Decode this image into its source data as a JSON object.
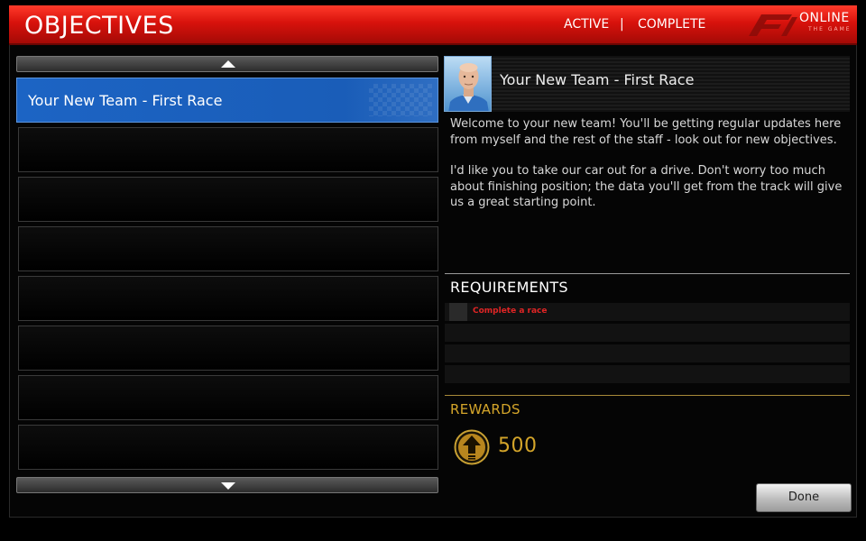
{
  "header": {
    "title": "OBJECTIVES",
    "tabs": {
      "active": "ACTIVE",
      "separator": "|",
      "complete": "COMPLETE"
    },
    "logo": {
      "text": "ONLINE",
      "sub": "THE GAME",
      "icon": "f1-logo-icon"
    }
  },
  "objectives": {
    "scroll_up_icon": "chevron-up-icon",
    "scroll_down_icon": "chevron-down-icon",
    "items": [
      {
        "label": "Your New Team - First Race",
        "selected": true
      },
      {
        "label": ""
      },
      {
        "label": ""
      },
      {
        "label": ""
      },
      {
        "label": ""
      },
      {
        "label": ""
      },
      {
        "label": ""
      },
      {
        "label": ""
      }
    ]
  },
  "detail": {
    "title": "Your New Team - First Race",
    "message": [
      "Welcome to your new team! You'll be getting regular updates here from myself and the rest of the staff - look out for new objectives.",
      "I'd like you to take our car out for a drive. Don't worry too much about finishing position; the data you'll get from the track will give us a great starting point."
    ]
  },
  "requirements": {
    "title": "REQUIREMENTS",
    "items": [
      {
        "text": "Complete a race"
      },
      {
        "text": ""
      },
      {
        "text": ""
      },
      {
        "text": ""
      }
    ]
  },
  "rewards": {
    "title": "REWARDS",
    "icon": "upgrade-arrow-icon",
    "value": "500"
  },
  "done_label": "Done",
  "colors": {
    "header_red": "#d8120c",
    "selected_blue": "#1c64c4",
    "reward_gold": "#d4a52a",
    "requirement_red": "#e02525"
  }
}
